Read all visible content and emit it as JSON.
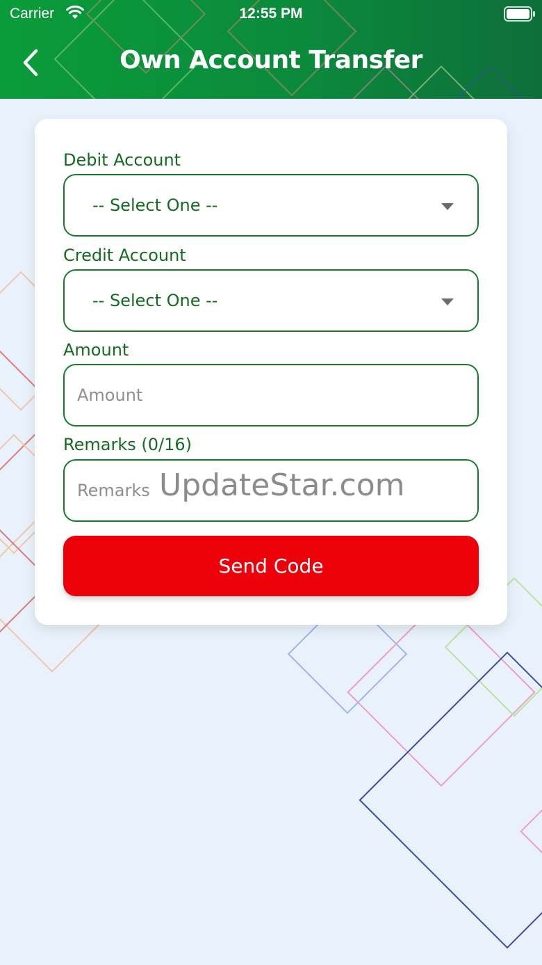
{
  "status_bar": {
    "carrier": "Carrier",
    "time": "12:55 PM"
  },
  "header": {
    "title": "Own Account Transfer",
    "back_icon": "chevron-left-icon"
  },
  "form": {
    "debit_account": {
      "label": "Debit Account",
      "value": "-- Select One --"
    },
    "credit_account": {
      "label": "Credit Account",
      "value": "-- Select One --"
    },
    "amount": {
      "label": "Amount",
      "placeholder": "Amount",
      "value": ""
    },
    "remarks": {
      "label": "Remarks (0/16)",
      "placeholder": "Remarks",
      "value": ""
    },
    "watermark": "UpdateStar.com",
    "submit_label": "Send Code"
  },
  "colors": {
    "header_green": "#0a9c3a",
    "label_green": "#156b22",
    "border_green": "#157a2a",
    "button_red": "#ec0009",
    "background": "#e9f1fb"
  }
}
